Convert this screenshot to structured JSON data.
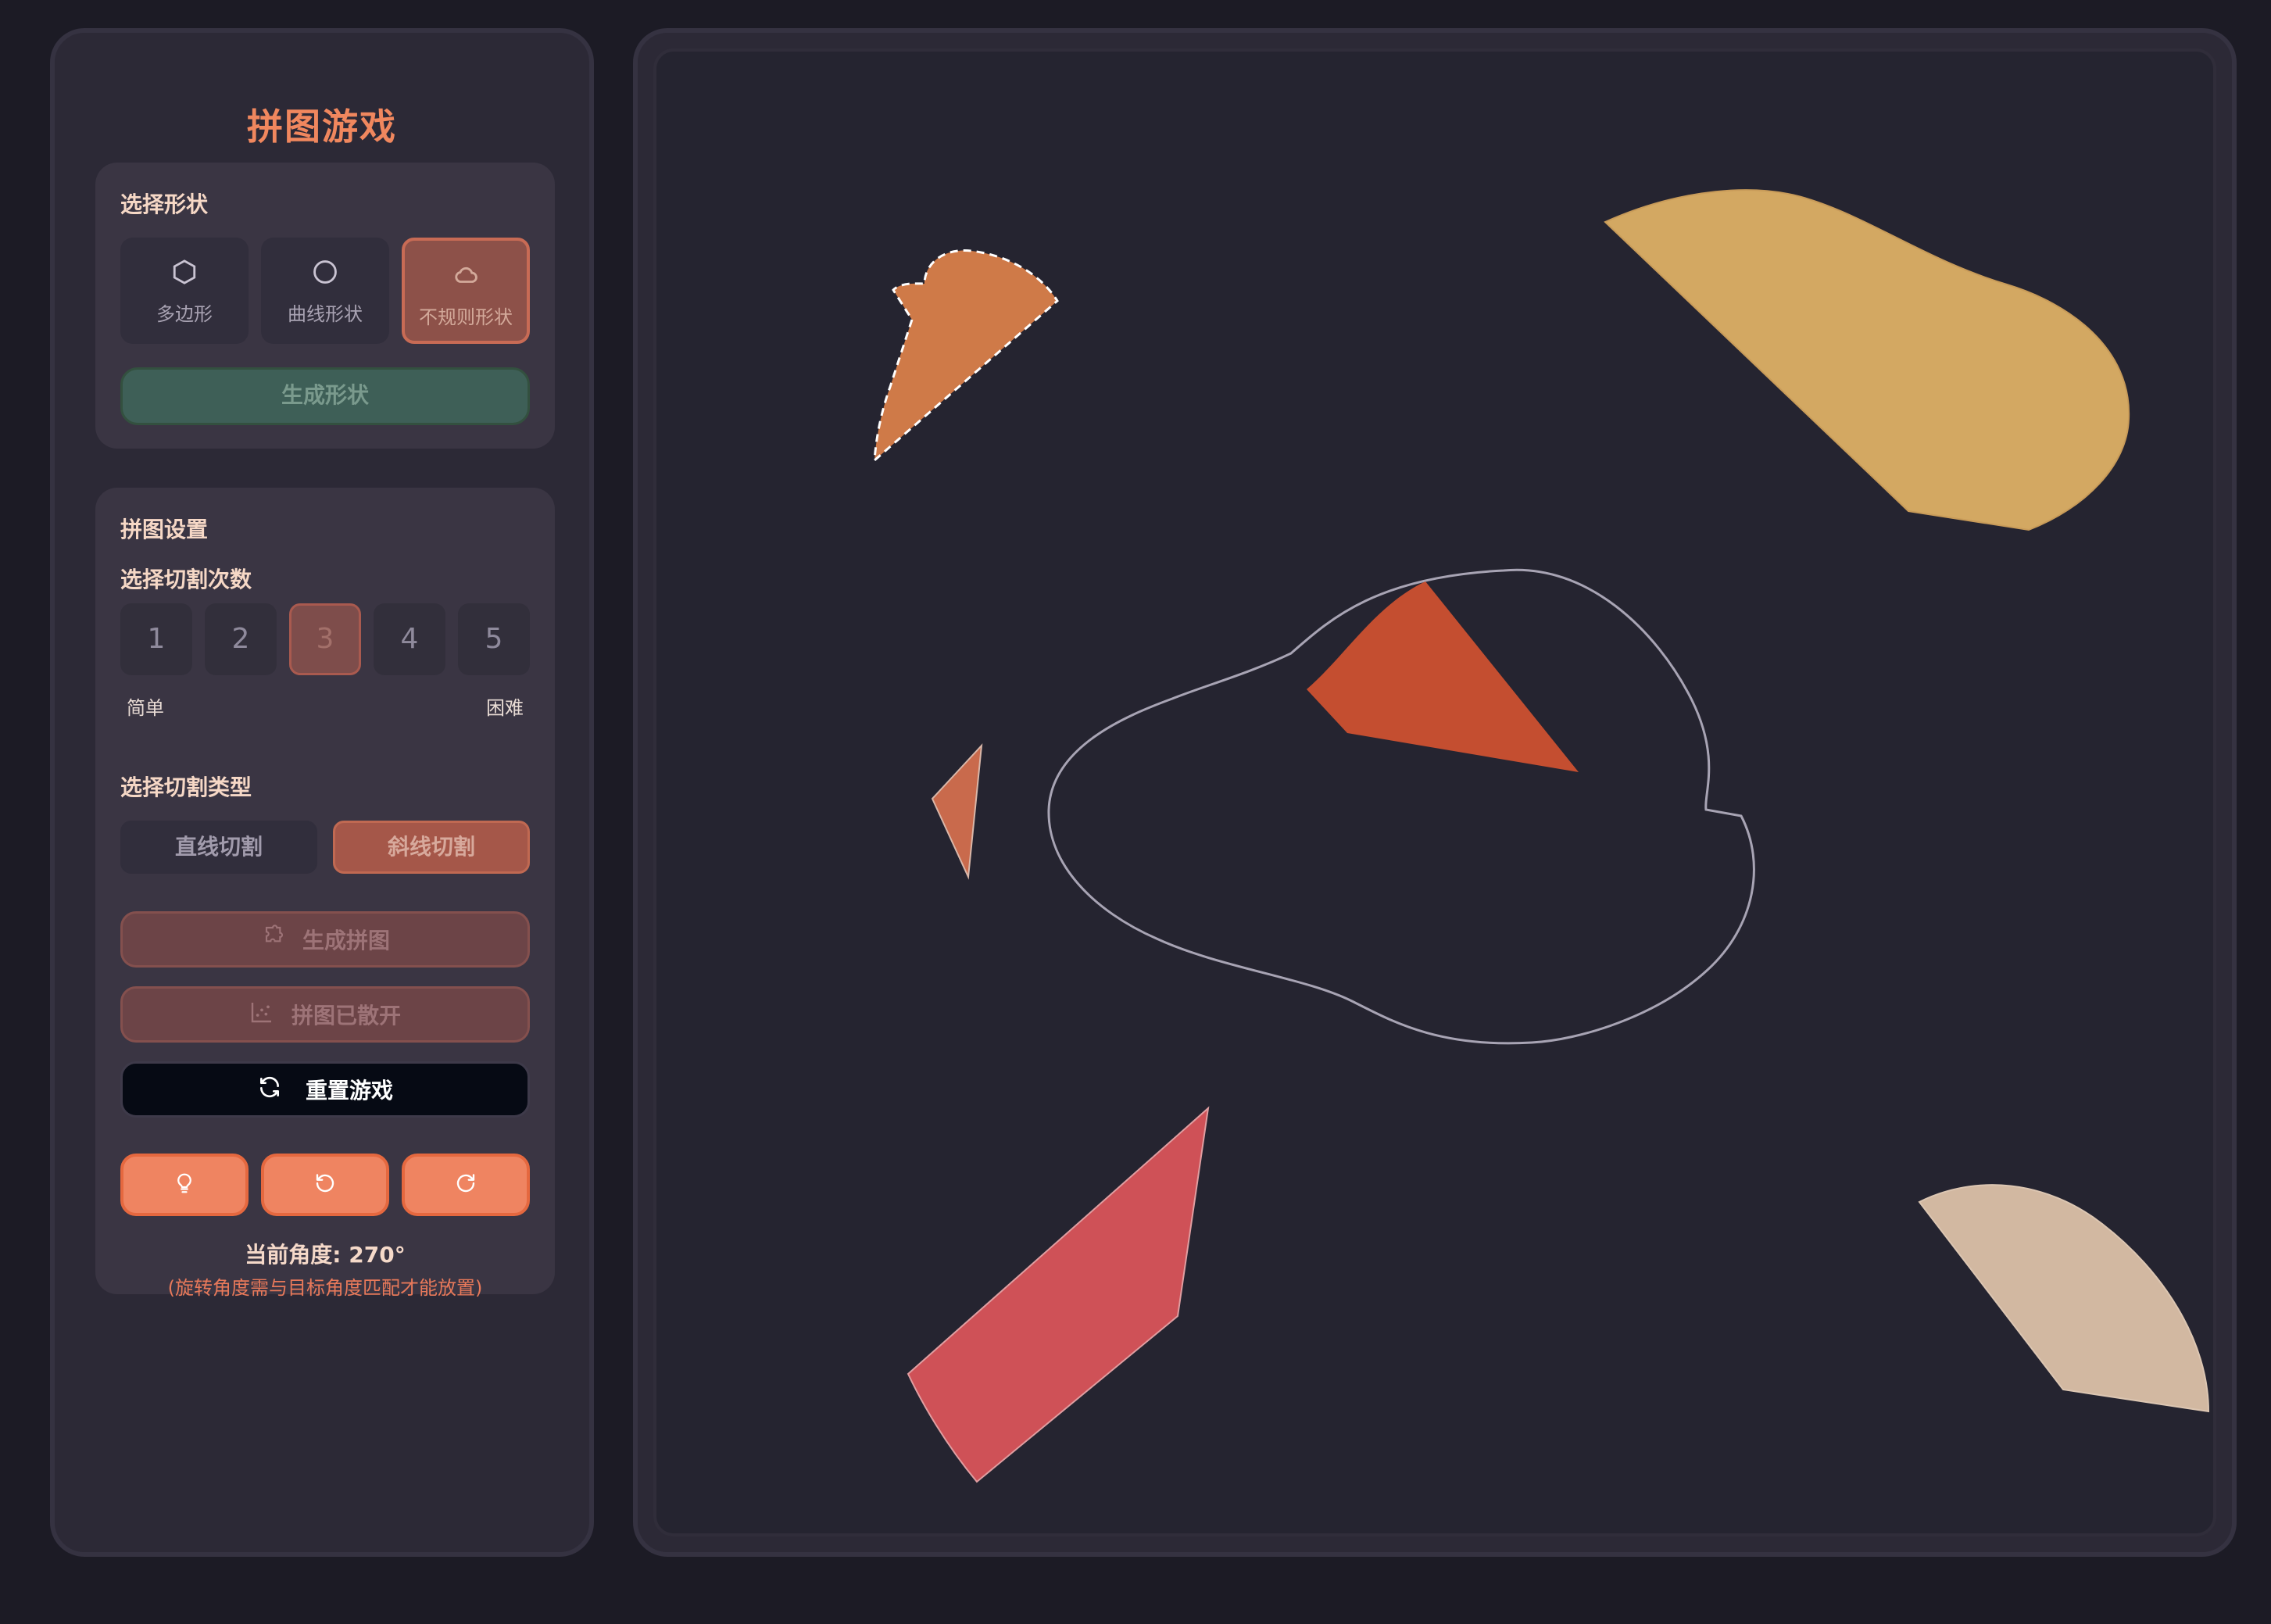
{
  "app": {
    "title": "拼图游戏"
  },
  "shape_panel": {
    "label": "选择形状",
    "options": [
      {
        "label": "多边形",
        "icon": "hexagon-icon",
        "active": false
      },
      {
        "label": "曲线形状",
        "icon": "circle-icon",
        "active": false
      },
      {
        "label": "不规则形状",
        "icon": "cloud-icon",
        "active": true
      }
    ],
    "generate_label": "生成形状"
  },
  "settings_panel": {
    "label": "拼图设置",
    "cut_count_label": "选择切割次数",
    "cut_counts": [
      "1",
      "2",
      "3",
      "4",
      "5"
    ],
    "selected_cut_count": "3",
    "easy_label": "简单",
    "hard_label": "困难",
    "cut_type_label": "选择切割类型",
    "cut_types": [
      "直线切割",
      "斜线切割"
    ],
    "selected_cut_type": "斜线切割",
    "generate_puzzle_label": "生成拼图",
    "scattered_label": "拼图已散开",
    "reset_label": "重置游戏",
    "tools": [
      "lightbulb-icon",
      "rotate-left-icon",
      "rotate-right-icon"
    ],
    "current_angle": "当前角度: 270°",
    "angle_note": "(旋转角度需与目标角度匹配才能放置)"
  },
  "colors": {
    "accent": "#f0875e",
    "target_outline": "#a8a4b4",
    "piece_selected": "#cf7a48",
    "piece_yellow": "#d3a862",
    "piece_red_orange": "#c44e30",
    "piece_small": "#c96a4c",
    "piece_red": "#cf5157",
    "piece_beige": "#d2b8a1"
  }
}
